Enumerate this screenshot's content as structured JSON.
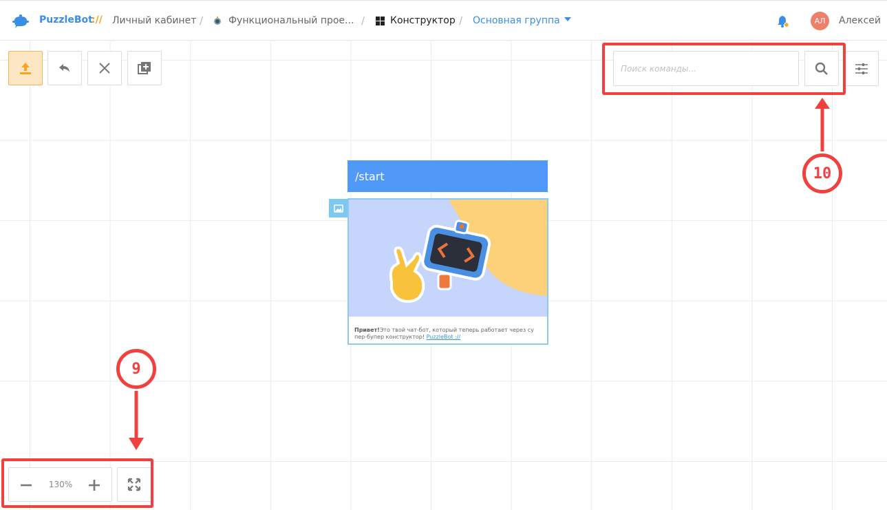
{
  "header": {
    "brand": "PuzzleBot",
    "brand_slashes": "://",
    "crumbs": {
      "cabinet": "Личный кабинет",
      "project": "Функциональный прое...",
      "constructor": "Конструктор",
      "group": "Основная группа"
    },
    "user_initials": "АЛ",
    "user_name": "Алексей"
  },
  "toolbar": {
    "search_placeholder": "Поиск команды..."
  },
  "command_block": {
    "command": "/start",
    "message_bold": "Привет!",
    "message_text": "Это твой чат-бот, который теперь работает через су пер-бупер конструктор! ",
    "message_link": "PuzzleBot ://"
  },
  "zoom": {
    "value": "130%"
  },
  "annotations": {
    "nine": "9",
    "ten": "10"
  },
  "colors": {
    "accent": "#3a8ee6",
    "brand_orange": "#f5a623",
    "command_header": "#5199f8",
    "annotation_red": "#f0413f"
  }
}
